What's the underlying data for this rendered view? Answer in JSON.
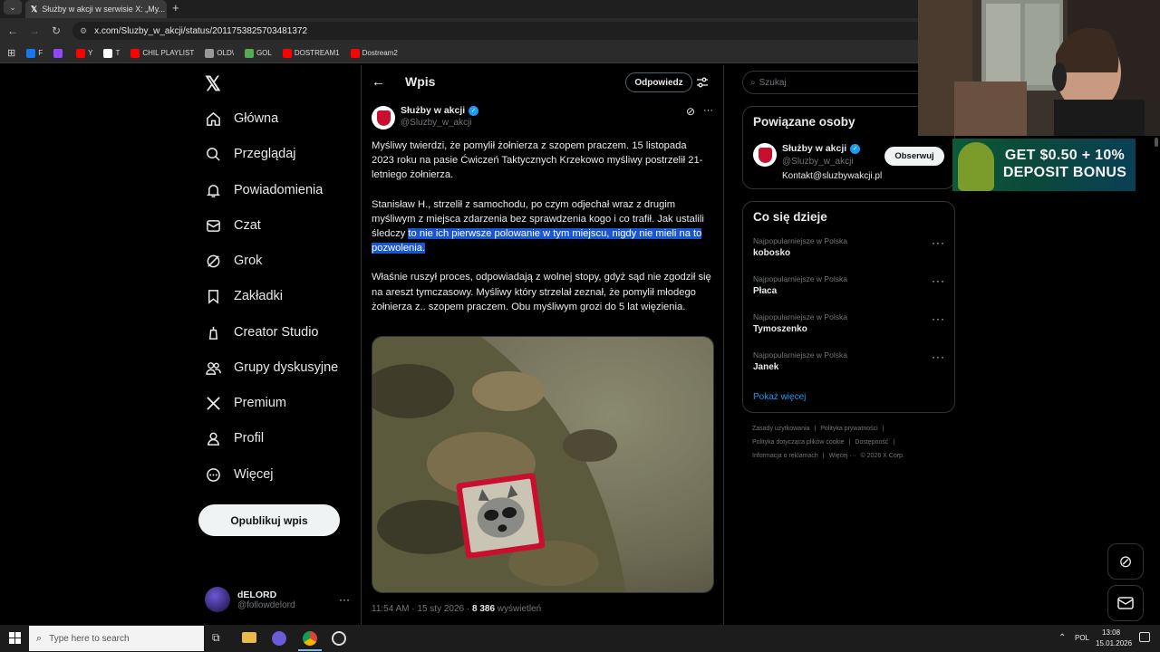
{
  "browser": {
    "tab_title": "Służby w akcji w serwisie X: „My...",
    "url": "x.com/Sluzby_w_akcji/status/2011753825703481372",
    "bookmarks": [
      {
        "label": "F",
        "color": "#1877f2"
      },
      {
        "label": "",
        "color": "#9146ff"
      },
      {
        "label": "Y",
        "color": "#ff0000"
      },
      {
        "label": "T",
        "color": "#ffffff"
      },
      {
        "label": "CHIL PLAYLIST",
        "color": "#ff0000"
      },
      {
        "label": "OLD\\",
        "color": "#999999"
      },
      {
        "label": "GOL",
        "color": "#55aa55"
      },
      {
        "label": "DOSTREAM1",
        "color": "#ff0000"
      },
      {
        "label": "Dostream2",
        "color": "#ff0000"
      }
    ]
  },
  "nav": {
    "items": [
      {
        "label": "Główna",
        "icon": "home-icon"
      },
      {
        "label": "Przeglądaj",
        "icon": "search-icon"
      },
      {
        "label": "Powiadomienia",
        "icon": "bell-icon"
      },
      {
        "label": "Czat",
        "icon": "mail-icon"
      },
      {
        "label": "Grok",
        "icon": "grok-icon"
      },
      {
        "label": "Zakładki",
        "icon": "bookmark-icon"
      },
      {
        "label": "Creator Studio",
        "icon": "creator-icon"
      },
      {
        "label": "Grupy dyskusyjne",
        "icon": "people-icon"
      },
      {
        "label": "Premium",
        "icon": "x-icon"
      },
      {
        "label": "Profil",
        "icon": "person-icon"
      },
      {
        "label": "Więcej",
        "icon": "more-circle-icon"
      }
    ],
    "post_button": "Opublikuj wpis",
    "account": {
      "name": "dELORD",
      "handle": "@followdelord"
    }
  },
  "center": {
    "header_title": "Wpis",
    "reply_button": "Odpowiedz",
    "author": {
      "name": "Służby w akcji",
      "handle": "@Sluzby_w_akcji"
    },
    "para1": "Myśliwy twierdzi, że pomylił żołnierza z szopem praczem. 15 listopada 2023 roku na pasie Ćwiczeń Taktycznych Krzekowo myśliwy postrzelił 21-letniego żołnierza.",
    "para2_plain": "Stanisław H.,  strzelił z samochodu, po czym odjechał wraz z drugim myśliwym z miejsca zdarzenia bez sprawdzenia kogo i co trafił. Jak ustalili śledczy ",
    "para2_highlight": "to nie ich pierwsze polowanie w tym miejscu, nigdy nie mieli na to pozwolenia.",
    "para3": "Właśnie ruszył proces, odpowiadają z wolnej stopy, gdyż sąd nie zgodził się na areszt tymczasowy. Myśliwy który strzelał zeznał, że pomylił młodego żołnierza z.. szopem praczem. Obu myśliwym grozi do 5 lat więzienia.",
    "meta_time": "11:54 AM · 15 sty 2026 · ",
    "meta_views": "8 386",
    "meta_views_label": " wyświetleń"
  },
  "right": {
    "search_placeholder": "Szukaj",
    "related_title": "Powiązane osoby",
    "related": {
      "name": "Służby w akcji",
      "handle": "@Sluzby_w_akcji",
      "bio": "Kontakt@sluzbywakcji.pl",
      "follow": "Obserwuj"
    },
    "trends_title": "Co się dzieje",
    "trends": [
      {
        "category": "Najpopularniejsze w Polska",
        "name": "kobosko"
      },
      {
        "category": "Najpopularniejsze w Polska",
        "name": "Płaca"
      },
      {
        "category": "Najpopularniejsze w Polska",
        "name": "Tymoszenko"
      },
      {
        "category": "Najpopularniejsze w Polska",
        "name": "Janek"
      }
    ],
    "show_more": "Pokaż więcej",
    "footer": [
      [
        "Zasady użytkowania",
        "|",
        "Polityka prywatności",
        "|"
      ],
      [
        "Polityka dotycząca plików cookie",
        "|",
        "Dostępność",
        "|"
      ],
      [
        "Informacja o reklamach",
        "|",
        "Więcej ···",
        "© 2026 X Corp."
      ]
    ]
  },
  "ad": {
    "line1": "GET $0.50 + 10%",
    "line2": "DEPOSIT BONUS"
  },
  "taskbar": {
    "search_placeholder": "Type here to search",
    "lang": "POL",
    "time": "13:08",
    "date": "15.01.2026"
  },
  "colors": {
    "accent": "#1d9bf0",
    "highlight": "#1a55d6",
    "verified": "#1d9bf0"
  }
}
